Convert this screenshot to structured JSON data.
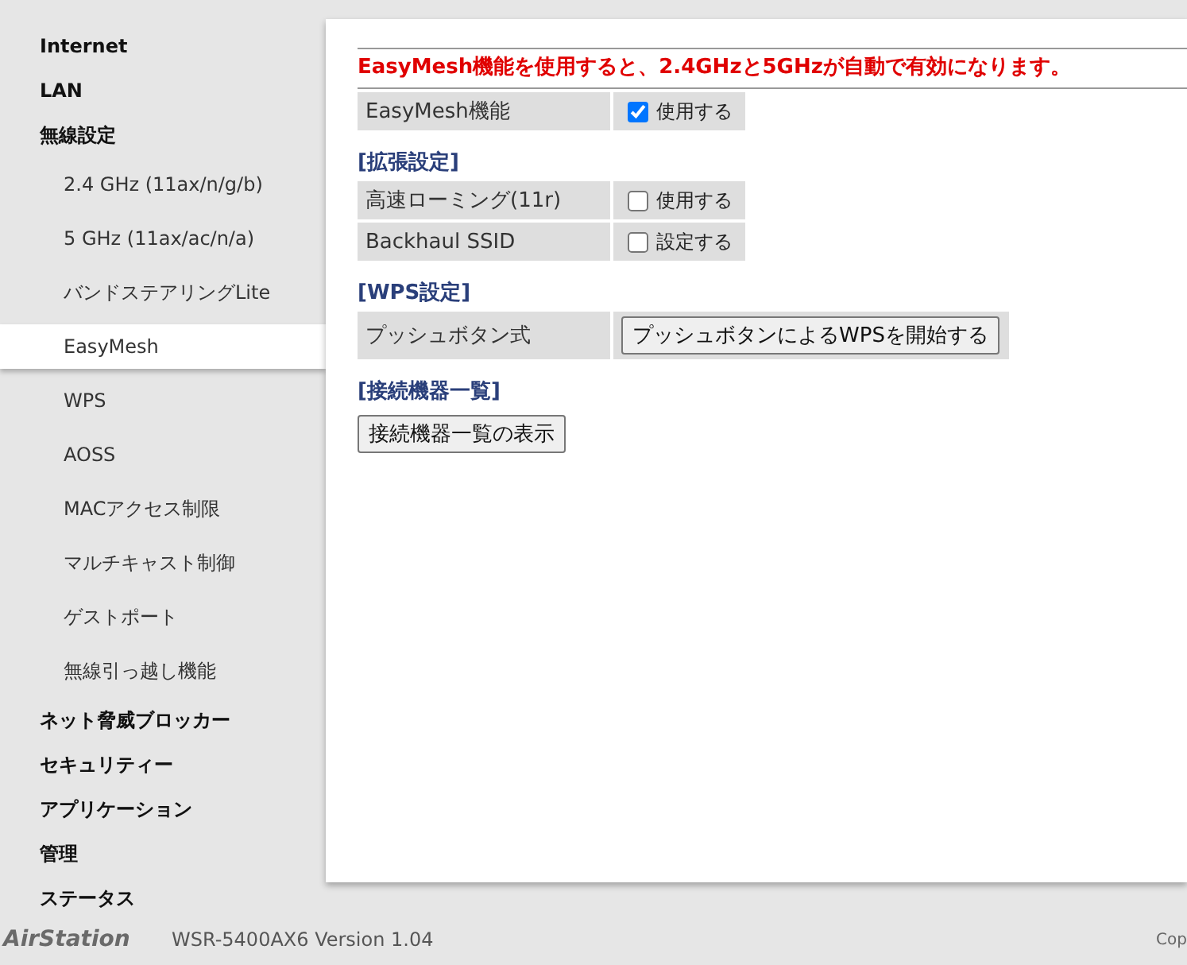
{
  "sidebar": {
    "items": [
      {
        "label": "Internet",
        "selected": false
      },
      {
        "label": "LAN",
        "selected": false
      },
      {
        "label": "無線設定",
        "selected": false,
        "children": [
          {
            "label": "2.4 GHz (11ax/n/g/b)",
            "selected": false
          },
          {
            "label": "5 GHz (11ax/ac/n/a)",
            "selected": false
          },
          {
            "label": "バンドステアリングLite",
            "selected": false
          },
          {
            "label": "EasyMesh",
            "selected": true
          },
          {
            "label": "WPS",
            "selected": false
          },
          {
            "label": "AOSS",
            "selected": false
          },
          {
            "label": "MACアクセス制限",
            "selected": false
          },
          {
            "label": "マルチキャスト制御",
            "selected": false
          },
          {
            "label": "ゲストポート",
            "selected": false
          },
          {
            "label": "無線引っ越し機能",
            "selected": false
          }
        ]
      },
      {
        "label": "ネット脅威ブロッカー",
        "selected": false
      },
      {
        "label": "セキュリティー",
        "selected": false
      },
      {
        "label": "アプリケーション",
        "selected": false
      },
      {
        "label": "管理",
        "selected": false
      },
      {
        "label": "ステータス",
        "selected": false
      }
    ]
  },
  "content": {
    "notice": "EasyMesh機能を使用すると、2.4GHzと5GHzが自動で有効になります。",
    "sections": [
      {
        "rows": [
          {
            "kind": "checkbox",
            "label": "EasyMesh機能",
            "checked": true,
            "option": "使用する"
          }
        ]
      },
      {
        "heading": "[拡張設定]",
        "rows": [
          {
            "kind": "checkbox",
            "label": "高速ローミング(11r)",
            "checked": false,
            "option": "使用する"
          },
          {
            "kind": "checkbox",
            "label": "Backhaul SSID",
            "checked": false,
            "option": "設定する"
          }
        ]
      },
      {
        "heading": "[WPS設定]",
        "rows": [
          {
            "kind": "button",
            "label": "プッシュボタン式",
            "button": "プッシュボタンによるWPSを開始する"
          }
        ]
      },
      {
        "heading": "[接続機器一覧]",
        "button": "接続機器一覧の表示"
      }
    ]
  },
  "footer": {
    "logo": "AirStation",
    "model": "WSR-5400AX6 Version 1.04",
    "copyright": "Cop"
  }
}
